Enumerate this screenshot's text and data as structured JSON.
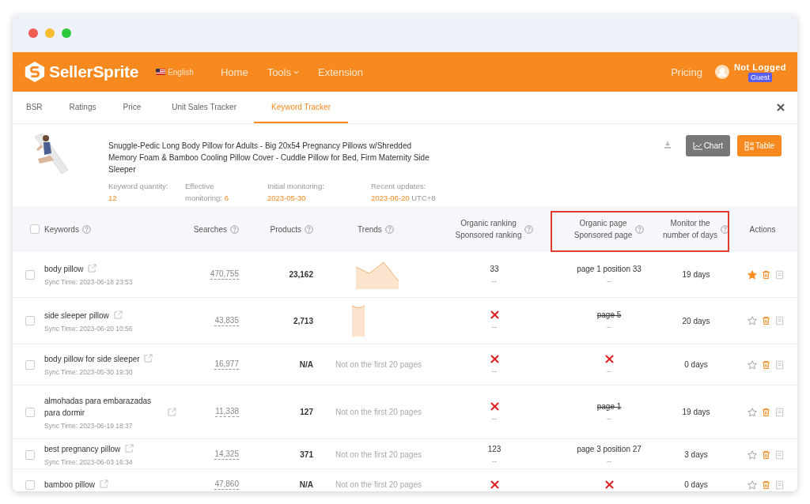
{
  "nav": {
    "brand": "SellerSprite",
    "language": "English",
    "links": [
      {
        "label": "Home",
        "dropdown": false
      },
      {
        "label": "Tools",
        "dropdown": true
      },
      {
        "label": "Extension",
        "dropdown": false
      }
    ],
    "pricing": "Pricing",
    "user": "Not Logged",
    "badge": "Guest"
  },
  "tabs": [
    {
      "label": "BSR",
      "selected": false
    },
    {
      "label": "Ratings",
      "selected": false
    },
    {
      "label": "Price",
      "selected": false
    },
    {
      "label": "Unit Sales Tracker",
      "selected": false
    },
    {
      "label": "Keyword Tracker",
      "selected": true
    }
  ],
  "product": {
    "kind": "picture",
    "title": "Snuggle-Pedic Long Body Pillow for Adults - Big 20x54 Pregnancy Pillows w/Shredded Memory Foam & Bamboo Cooling Pillow Cover - Cuddle Pillow for Bed, Firm Maternity Side Sleeper",
    "stats": [
      {
        "label": "Keyword quantity:",
        "value": "12"
      },
      {
        "label": "Effective monitoring:",
        "value": "6"
      },
      {
        "label": "Initial monitoring:",
        "value": "2023-05-30"
      },
      {
        "label": "Recent updates:",
        "value": "2023-06-20",
        "suffix": "UTC+8"
      }
    ]
  },
  "views": [
    {
      "label": "Chart",
      "selected": false
    },
    {
      "label": "Table",
      "selected": true
    }
  ],
  "table": {
    "select_all": false,
    "columns": [
      {
        "lines": [
          "Keywords"
        ],
        "help": true
      },
      {
        "lines": [
          "Searches"
        ],
        "help": true
      },
      {
        "lines": [
          "Products"
        ],
        "help": true
      },
      {
        "lines": [
          "Trends"
        ],
        "help": true
      },
      {
        "lines": [
          "Organic ranking",
          "Sponsored ranking"
        ],
        "help": true
      },
      {
        "lines": [
          "Organic page",
          "Sponsored page"
        ],
        "help": true,
        "highlighted": true
      },
      {
        "lines": [
          "Monitor the",
          "number of days"
        ],
        "help": true,
        "highlighted": true
      },
      {
        "lines": [
          "Actions"
        ],
        "help": false
      }
    ],
    "rows": [
      {
        "keyword": "body pillow",
        "sync_time": "Sync Time: 2023-06-18 23:53",
        "searches": "470,755",
        "products": "23,162",
        "trend": {
          "kind": "peak"
        },
        "organic_rank": {
          "kind": "value",
          "text": "33"
        },
        "sponsored_rank": "--",
        "organic_page": {
          "kind": "value",
          "text": "page 1 position 33"
        },
        "sponsored_page": "--",
        "days": "19 days",
        "starred": true,
        "checked": false
      },
      {
        "keyword": "side sleeper pillow",
        "sync_time": "Sync Time: 2023-06-20 10:56",
        "searches": "43,835",
        "products": "2,713",
        "trend": {
          "kind": "column"
        },
        "organic_rank": {
          "kind": "none"
        },
        "sponsored_rank": "--",
        "organic_page": {
          "kind": "lost",
          "text": "page 5"
        },
        "sponsored_page": "--",
        "days": "20 days",
        "starred": false,
        "checked": false
      },
      {
        "keyword": "body pillow for side sleeper",
        "sync_time": "Sync Time: 2023-05-30 19:30",
        "searches": "16,977",
        "products": "N/A",
        "trend": {
          "kind": "text",
          "text": "Not on the first 20 pages"
        },
        "organic_rank": {
          "kind": "none"
        },
        "sponsored_rank": "--",
        "organic_page": {
          "kind": "none"
        },
        "sponsored_page": "--",
        "days": "0 days",
        "starred": false,
        "checked": false
      },
      {
        "keyword": "almohadas para embarazadas para dormir",
        "sync_time": "Sync Time: 2023-06-19 18:37",
        "searches": "11,338",
        "products": "127",
        "trend": {
          "kind": "text",
          "text": "Not on the first 20 pages"
        },
        "organic_rank": {
          "kind": "none"
        },
        "sponsored_rank": "--",
        "organic_page": {
          "kind": "lost",
          "text": "page 1"
        },
        "sponsored_page": "--",
        "days": "19 days",
        "starred": false,
        "checked": false
      },
      {
        "keyword": "best pregnancy pillow",
        "sync_time": "Sync Time: 2023-06-03 16:34",
        "searches": "14,325",
        "products": "371",
        "trend": {
          "kind": "text",
          "text": "Not on the first 20 pages"
        },
        "organic_rank": {
          "kind": "value",
          "text": "123"
        },
        "sponsored_rank": "--",
        "organic_page": {
          "kind": "value",
          "text": "page 3 position 27"
        },
        "sponsored_page": "--",
        "days": "3 days",
        "starred": false,
        "checked": false
      },
      {
        "keyword": "bamboo pillow",
        "searches": "47,860",
        "products": "N/A",
        "trend": {
          "kind": "text",
          "text": "Not on the first 20 pages"
        },
        "organic_rank": {
          "kind": "none"
        },
        "organic_page": {
          "kind": "none"
        },
        "days": "0 days",
        "starred": false,
        "checked": false
      }
    ]
  }
}
